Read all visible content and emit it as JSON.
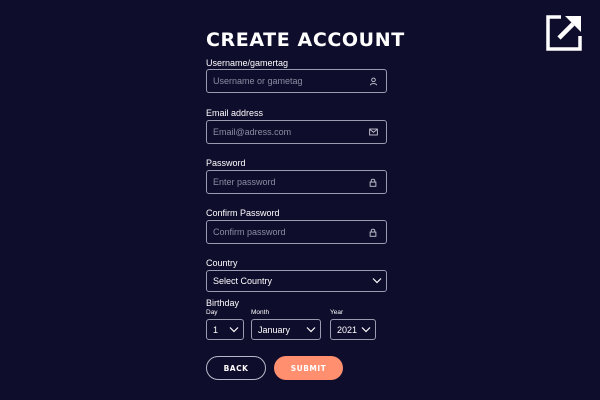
{
  "title": "CREATE ACCOUNT",
  "fields": {
    "username": {
      "label": "Username/gamertag",
      "placeholder": "Username or gametag",
      "icon": "user-icon"
    },
    "email": {
      "label": "Email address",
      "placeholder": "Email@adress.com",
      "icon": "mail-icon"
    },
    "password": {
      "label": "Password",
      "placeholder": "Enter password",
      "icon": "lock-icon"
    },
    "confirm_password": {
      "label": "Confirm Password",
      "placeholder": "Confirm password",
      "icon": "lock-icon"
    }
  },
  "country": {
    "label": "Country",
    "value": "Select Country"
  },
  "birthday": {
    "label": "Birthday",
    "day": {
      "label": "Day",
      "value": "1"
    },
    "month": {
      "label": "Month",
      "value": "January"
    },
    "year": {
      "label": "Year",
      "value": "2021"
    }
  },
  "buttons": {
    "back": "BACK",
    "submit": "SUBMIT"
  },
  "colors": {
    "background": "#0f0d2c",
    "accent": "#ff8f6e",
    "border": "#9a9ab0"
  },
  "icons": {
    "external": "external-link-icon",
    "chevron": "chevron-down-icon"
  }
}
